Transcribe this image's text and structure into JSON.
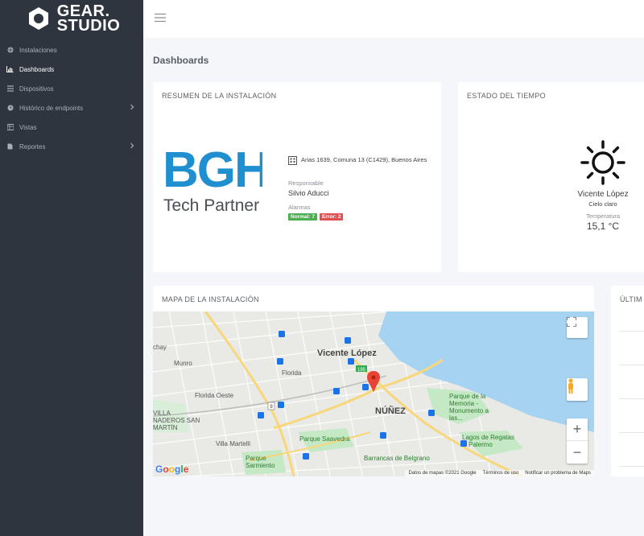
{
  "brand": {
    "line1": "GEAR.",
    "line2": "STUDIO"
  },
  "sidebar": {
    "items": [
      {
        "label": "Instalaciones",
        "icon": "globe-icon",
        "active": false,
        "has_submenu": false
      },
      {
        "label": "Dashboards",
        "icon": "chart-icon",
        "active": true,
        "has_submenu": false
      },
      {
        "label": "Dispositivos",
        "icon": "list-icon",
        "active": false,
        "has_submenu": false
      },
      {
        "label": "Histórico de endpoints",
        "icon": "clock-icon",
        "active": false,
        "has_submenu": true
      },
      {
        "label": "Vistas",
        "icon": "grid-icon",
        "active": false,
        "has_submenu": false
      },
      {
        "label": "Reportes",
        "icon": "file-icon",
        "active": false,
        "has_submenu": true
      }
    ]
  },
  "page": {
    "title": "Dashboards"
  },
  "summary": {
    "title": "RESUMEN DE LA INSTALACIÓN",
    "logo_text": "BGH",
    "logo_subtitle": "Tech Partner",
    "address": "Arias 1639, Comuna 13 (C1429), Buenos Aires",
    "responsable_label": "Responsable",
    "responsable_value": "Silvio Aducci",
    "alarmas_label": "Alarmas",
    "badge_normal": "Normal: 7",
    "badge_error": "Error: 2"
  },
  "weather": {
    "title": "ESTADO DEL TIEMPO",
    "city": "Vicente López",
    "condition": "Cielo claro",
    "temp_label": "Temperatura",
    "temp_value": "15,1 °C"
  },
  "map": {
    "title": "MAPA DE LA INSTALACIÓN",
    "labels": {
      "vicente_lopez": "Vicente López",
      "nunez": "NÚÑEZ",
      "munro": "Munro",
      "florida": "Florida",
      "florida_oeste": "Florida Oeste",
      "villa_martelli": "Villa Martelli",
      "parque_saavedra": "Parque Saavedra",
      "parque_sarmiento": "Parque Sarmiento",
      "barrancas": "Barrancas de Belgrano",
      "parque_memoria": "Parque de la Memoria - Monumento a las...",
      "lagos_regatas": "Lagos de Regatas",
      "palermo": "Palermo",
      "chay": "chay",
      "villa_naderos": "VILLA NADEROS SAN MARTÍN",
      "route_195": "195",
      "route_9": "9"
    },
    "attribution": "Datos de mapas ©2021 Google",
    "terms": "Términos de uso",
    "report": "Notificar un problema de Maps",
    "zoom_in": "+",
    "zoom_out": "−",
    "google_letters": [
      "G",
      "o",
      "o",
      "g",
      "l",
      "e"
    ]
  },
  "last": {
    "title": "ÚLTIM"
  }
}
